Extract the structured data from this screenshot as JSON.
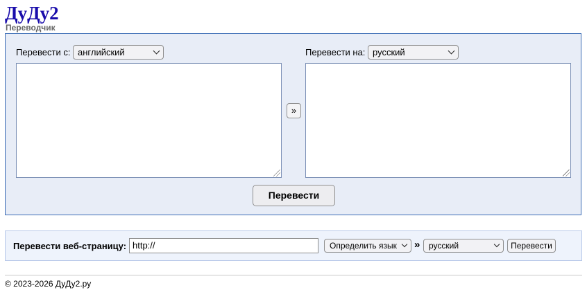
{
  "header": {
    "logo": "ДуДу2",
    "subtitle": "Переводчик"
  },
  "translator": {
    "from_label": "Перевести с:",
    "from_language": "английский",
    "to_label": "Перевести на:",
    "to_language": "русский",
    "source_text": "",
    "target_text": "",
    "swap_label": "»",
    "translate_button": "Перевести"
  },
  "web_translate": {
    "label": "Перевести веб-страницу:",
    "url_value": "http://",
    "detect_language": "Определить язык",
    "arrow": "»",
    "target_language": "русский",
    "button": "Перевести"
  },
  "footer": {
    "copyright": "© 2023-2026 ДуДу2.ру"
  }
}
